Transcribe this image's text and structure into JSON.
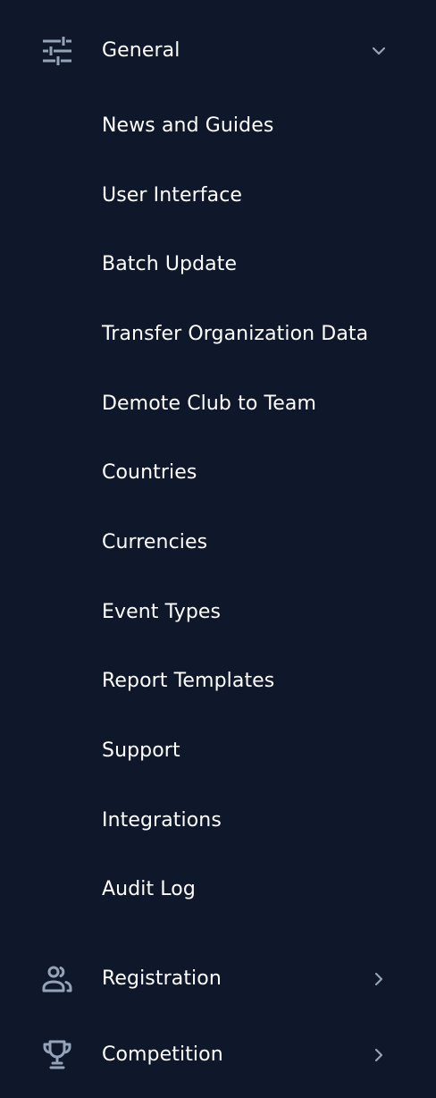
{
  "nav": {
    "general": {
      "label": "General",
      "icon": "sliders-icon",
      "expanded": true,
      "items": [
        {
          "label": "News and Guides"
        },
        {
          "label": "User Interface"
        },
        {
          "label": "Batch Update"
        },
        {
          "label": "Transfer Organization Data"
        },
        {
          "label": "Demote Club to Team"
        },
        {
          "label": "Countries"
        },
        {
          "label": "Currencies"
        },
        {
          "label": "Event Types"
        },
        {
          "label": "Report Templates"
        },
        {
          "label": "Support"
        },
        {
          "label": "Integrations"
        },
        {
          "label": "Audit Log"
        }
      ]
    },
    "registration": {
      "label": "Registration",
      "icon": "users-icon",
      "expanded": false
    },
    "competition": {
      "label": "Competition",
      "icon": "trophy-icon",
      "expanded": false
    }
  },
  "colors": {
    "background": "#0f172a",
    "text": "#ffffff",
    "icon": "#94a3b8"
  }
}
